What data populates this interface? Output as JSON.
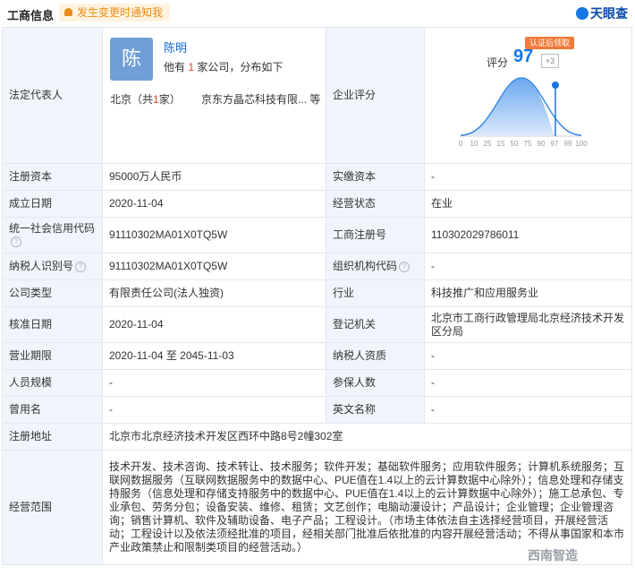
{
  "header": {
    "title": "工商信息",
    "notify_label": "发生变更时通知我",
    "brand": "天眼查"
  },
  "legal": {
    "label": "法定代表人",
    "avatar_char": "陈",
    "name": "陈明",
    "has_prefix": "他有 ",
    "count": "1",
    "has_suffix": " 家公司，分布如下",
    "region_prefix": "北京（共",
    "region_count": "1",
    "region_suffix": "家）",
    "company": "京东方晶芯科技有限...  等"
  },
  "score": {
    "label": "企业评分",
    "score_label": "评分",
    "value": "97",
    "plus": "+3",
    "badge": "认证后领取",
    "ticks": [
      "0",
      "10",
      "25",
      "15",
      "50",
      "75",
      "90",
      "97",
      "99",
      "100"
    ]
  },
  "rows": [
    {
      "l1": "注册资本",
      "v1": "95000万人民币",
      "l2": "实缴资本",
      "v2": "-"
    },
    {
      "l1": "成立日期",
      "v1": "2020-11-04",
      "l2": "经营状态",
      "v2": "在业"
    },
    {
      "l1": "统一社会信用代码",
      "v1": "91110302MA01X0TQ5W",
      "l2": "工商注册号",
      "v2": "110302029786011"
    },
    {
      "l1": "纳税人识别号",
      "v1": "91110302MA01X0TQ5W",
      "l2": "组织机构代码",
      "v2": "-"
    },
    {
      "l1": "公司类型",
      "v1": "有限责任公司(法人独资)",
      "l2": "行业",
      "v2": "科技推广和应用服务业"
    },
    {
      "l1": "核准日期",
      "v1": "2020-11-04",
      "l2": "登记机关",
      "v2": "北京市工商行政管理局北京经济技术开发区分局"
    },
    {
      "l1": "营业期限",
      "v1": "2020-11-04  至 2045-11-03",
      "l2": "纳税人资质",
      "v2": "-"
    },
    {
      "l1": "人员规模",
      "v1": "-",
      "l2": "参保人数",
      "v2": "-"
    },
    {
      "l1": "曾用名",
      "v1": "-",
      "l2": "英文名称",
      "v2": "-"
    }
  ],
  "address": {
    "label": "注册地址",
    "value": "北京市北京经济技术开发区西环中路8号2幢302室"
  },
  "scope": {
    "label": "经营范围",
    "value": "技术开发、技术咨询、技术转让、技术服务；软件开发；基础软件服务；应用软件服务；计算机系统服务；互联网数据服务（互联网数据服务中的数据中心、PUE值在1.4以上的云计算数据中心除外）；信息处理和存储支持服务（信息处理和存储支持服务中的数据中心、PUE值在1.4以上的云计算数据中心除外）；施工总承包、专业承包、劳务分包；设备安装、维修、租赁；文艺创作；电脑动漫设计；产品设计；企业管理；企业管理咨询；销售计算机、软件及辅助设备、电子产品；工程设计。（市场主体依法自主选择经营项目，开展经营活动；工程设计以及依法须经批准的项目，经相关部门批准后依批准的内容开展经营活动；不得从事国家和本市产业政策禁止和限制类项目的经营活动。）"
  },
  "watermark": "西南智造"
}
